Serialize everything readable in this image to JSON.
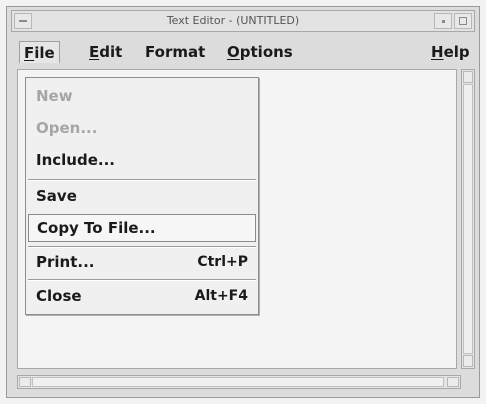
{
  "window": {
    "title": "Text Editor - (UNTITLED)"
  },
  "menubar": {
    "items": [
      {
        "label": "File",
        "mnemonic": "F",
        "rest": "ile",
        "active": true
      },
      {
        "label": "Edit",
        "mnemonic": "E",
        "rest": "dit"
      },
      {
        "label": "Format",
        "mnemonic": "",
        "rest": "Format"
      },
      {
        "label": "Options",
        "mnemonic": "O",
        "rest": "ptions"
      },
      {
        "label": "Help",
        "mnemonic": "H",
        "rest": "elp"
      }
    ]
  },
  "file_menu": {
    "items": [
      {
        "label": "New",
        "enabled": false
      },
      {
        "label": "Open...",
        "enabled": false
      },
      {
        "label": "Include...",
        "enabled": true
      },
      {
        "label": "Save",
        "enabled": true
      },
      {
        "label": "Copy To File...",
        "enabled": true,
        "highlighted": true
      },
      {
        "label": "Print...",
        "accelerator": "Ctrl+P",
        "enabled": true
      },
      {
        "label": "Close",
        "accelerator": "Alt+F4",
        "enabled": true
      }
    ]
  }
}
